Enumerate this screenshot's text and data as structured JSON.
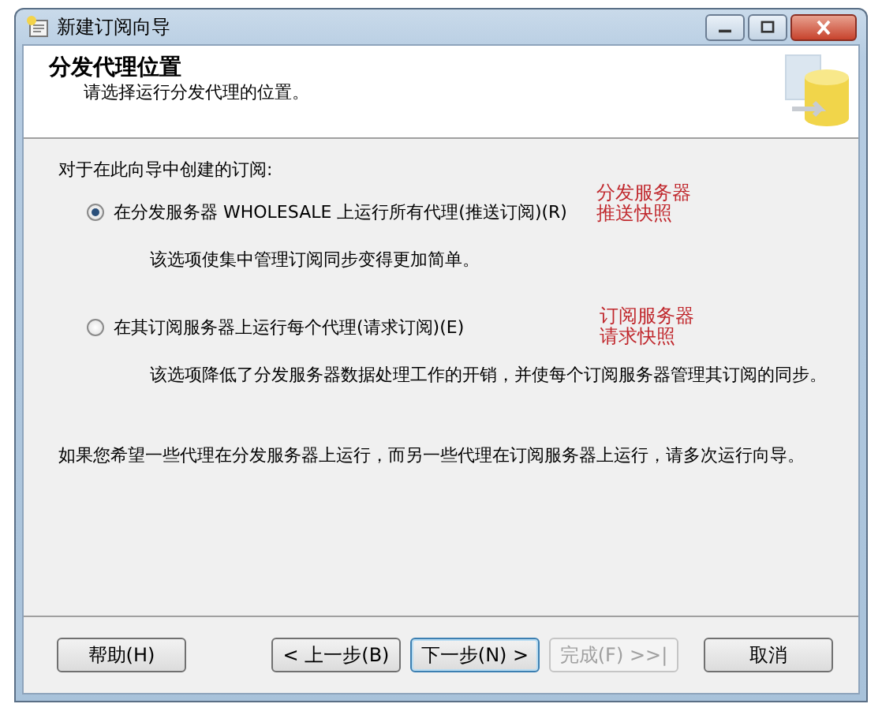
{
  "window": {
    "title": "新建订阅向导"
  },
  "header": {
    "title": "分发代理位置",
    "subtitle": "请选择运行分发代理的位置。"
  },
  "prompt": "对于在此向导中创建的订阅:",
  "options": [
    {
      "label": "在分发服务器 WHOLESALE 上运行所有代理(推送订阅)(R)",
      "description": "该选项使集中管理订阅同步变得更加简单。",
      "selected": true,
      "annotation": [
        "分发服务器",
        "推送快照"
      ]
    },
    {
      "label": "在其订阅服务器上运行每个代理(请求订阅)(E)",
      "description": "该选项降低了分发服务器数据处理工作的开销，并使每个订阅服务器管理其订阅的同步。",
      "selected": false,
      "annotation": [
        "订阅服务器",
        "请求快照"
      ]
    }
  ],
  "note": "如果您希望一些代理在分发服务器上运行，而另一些代理在订阅服务器上运行，请多次运行向导。",
  "help_button": {
    "label": "帮助(H)",
    "disabled": false
  },
  "nav_buttons": [
    {
      "label": "< 上一步(B)",
      "disabled": false,
      "focused": false
    },
    {
      "label": "下一步(N) >",
      "disabled": false,
      "focused": true
    },
    {
      "label": "完成(F) >>|",
      "disabled": true,
      "focused": false
    },
    {
      "label": "取消",
      "disabled": false,
      "focused": false
    }
  ]
}
